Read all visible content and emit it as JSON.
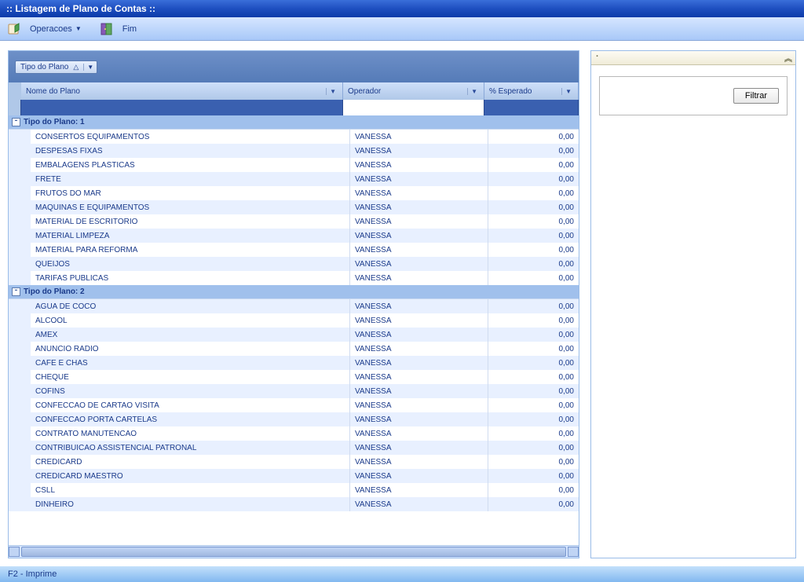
{
  "window": {
    "title": ":: Listagem de Plano de Contas ::"
  },
  "toolbar": {
    "operacoes_label": "Operacoes",
    "fim_label": "Fim"
  },
  "group_by": {
    "chip_label": "Tipo do Plano"
  },
  "columns": {
    "nome": "Nome do Plano",
    "operador": "Operador",
    "esperado": "% Esperado"
  },
  "groups": [
    {
      "header": "Tipo do Plano: 1",
      "rows": [
        {
          "nome": "CONSERTOS EQUIPAMENTOS",
          "operador": "VANESSA",
          "esperado": "0,00"
        },
        {
          "nome": "DESPESAS FIXAS",
          "operador": "VANESSA",
          "esperado": "0,00"
        },
        {
          "nome": "EMBALAGENS PLASTICAS",
          "operador": "VANESSA",
          "esperado": "0,00"
        },
        {
          "nome": "FRETE",
          "operador": "VANESSA",
          "esperado": "0,00"
        },
        {
          "nome": "FRUTOS DO MAR",
          "operador": "VANESSA",
          "esperado": "0,00"
        },
        {
          "nome": "MAQUINAS E EQUIPAMENTOS",
          "operador": "VANESSA",
          "esperado": "0,00"
        },
        {
          "nome": "MATERIAL DE ESCRITORIO",
          "operador": "VANESSA",
          "esperado": "0,00"
        },
        {
          "nome": "MATERIAL LIMPEZA",
          "operador": "VANESSA",
          "esperado": "0,00"
        },
        {
          "nome": "MATERIAL PARA REFORMA",
          "operador": "VANESSA",
          "esperado": "0,00"
        },
        {
          "nome": "QUEIJOS",
          "operador": "VANESSA",
          "esperado": "0,00"
        },
        {
          "nome": "TARIFAS PUBLICAS",
          "operador": "VANESSA",
          "esperado": "0,00"
        }
      ]
    },
    {
      "header": "Tipo do Plano: 2",
      "rows": [
        {
          "nome": "AGUA DE COCO",
          "operador": "VANESSA",
          "esperado": "0,00"
        },
        {
          "nome": "ALCOOL",
          "operador": "VANESSA",
          "esperado": "0,00"
        },
        {
          "nome": "AMEX",
          "operador": "VANESSA",
          "esperado": "0,00"
        },
        {
          "nome": "ANUNCIO RADIO",
          "operador": "VANESSA",
          "esperado": "0,00"
        },
        {
          "nome": "CAFE E CHAS",
          "operador": "VANESSA",
          "esperado": "0,00"
        },
        {
          "nome": "CHEQUE",
          "operador": "VANESSA",
          "esperado": "0,00"
        },
        {
          "nome": "COFINS",
          "operador": "VANESSA",
          "esperado": "0,00"
        },
        {
          "nome": "CONFECCAO DE CARTAO VISITA",
          "operador": "VANESSA",
          "esperado": "0,00"
        },
        {
          "nome": "CONFECCAO PORTA CARTELAS",
          "operador": "VANESSA",
          "esperado": "0,00"
        },
        {
          "nome": "CONTRATO MANUTENCAO",
          "operador": "VANESSA",
          "esperado": "0,00"
        },
        {
          "nome": "CONTRIBUICAO ASSISTENCIAL PATRONAL",
          "operador": "VANESSA",
          "esperado": "0,00"
        },
        {
          "nome": "CREDICARD",
          "operador": "VANESSA",
          "esperado": "0,00"
        },
        {
          "nome": "CREDICARD MAESTRO",
          "operador": "VANESSA",
          "esperado": "0,00"
        },
        {
          "nome": "CSLL",
          "operador": "VANESSA",
          "esperado": "0,00"
        },
        {
          "nome": "DINHEIRO",
          "operador": "VANESSA",
          "esperado": "0,00"
        }
      ]
    }
  ],
  "right_panel": {
    "filtrar_label": "Filtrar"
  },
  "statusbar": {
    "text": "F2 - Imprime"
  }
}
